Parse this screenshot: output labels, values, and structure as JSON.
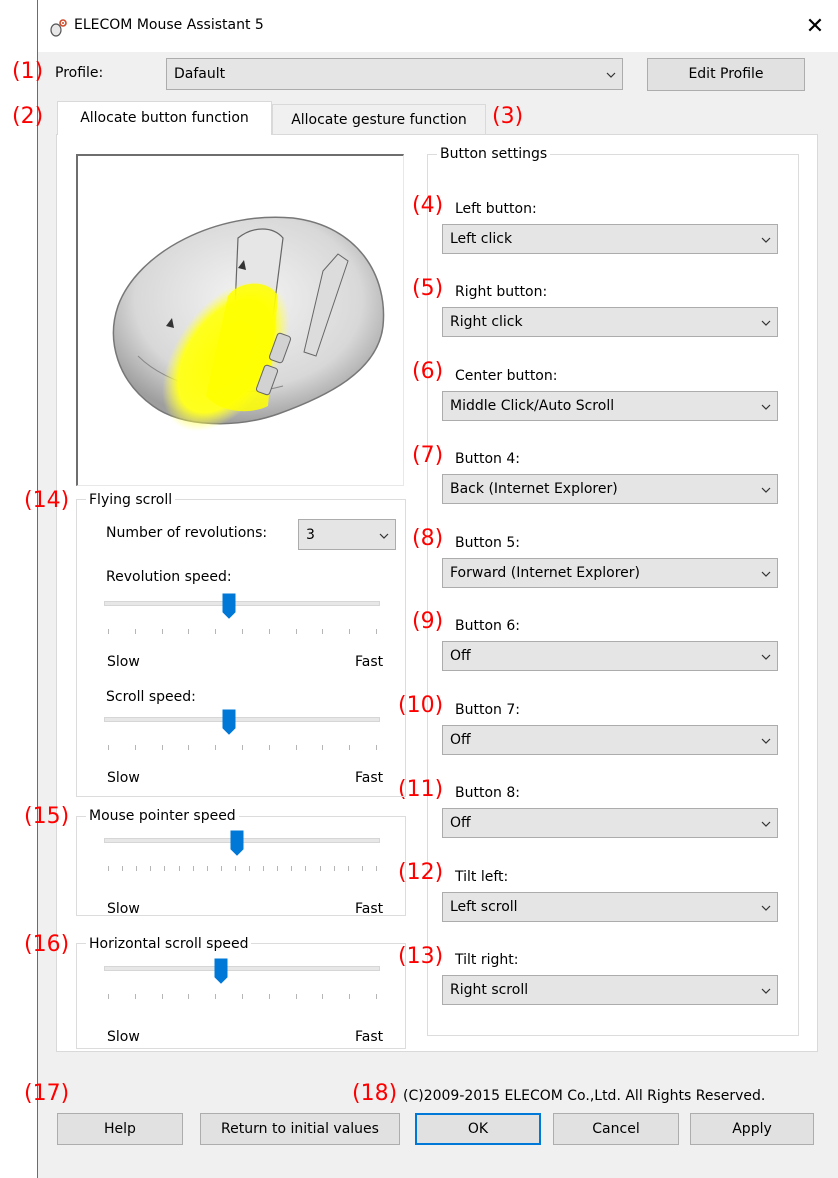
{
  "window": {
    "title": "ELECOM Mouse Assistant 5",
    "close_glyph": "✕"
  },
  "callouts": {
    "c1": "(1)",
    "c2": "(2)",
    "c3": "(3)",
    "c4": "(4)",
    "c5": "(5)",
    "c6": "(6)",
    "c7": "(7)",
    "c8": "(8)",
    "c9": "(9)",
    "c10": "(10)",
    "c11": "(11)",
    "c12": "(12)",
    "c13": "(13)",
    "c14": "(14)",
    "c15": "(15)",
    "c16": "(16)",
    "c17": "(17)",
    "c18": "(18)"
  },
  "profile": {
    "label": "Profile:",
    "value": "Dafault",
    "edit_button": "Edit Profile"
  },
  "tabs": {
    "button_function": "Allocate button function",
    "gesture_function": "Allocate gesture function"
  },
  "button_settings": {
    "title": "Button settings",
    "items": [
      {
        "label": "Left button:",
        "value": "Left click"
      },
      {
        "label": "Right button:",
        "value": "Right click"
      },
      {
        "label": "Center button:",
        "value": "Middle Click/Auto Scroll"
      },
      {
        "label": "Button 4:",
        "value": "Back (Internet Explorer)"
      },
      {
        "label": "Button 5:",
        "value": "Forward (Internet Explorer)"
      },
      {
        "label": "Button 6:",
        "value": "Off"
      },
      {
        "label": "Button 7:",
        "value": "Off"
      },
      {
        "label": "Button 8:",
        "value": "Off"
      },
      {
        "label": "Tilt left:",
        "value": "Left scroll"
      },
      {
        "label": "Tilt right:",
        "value": "Right scroll"
      }
    ]
  },
  "flying_scroll": {
    "title": "Flying scroll",
    "revolutions_label": "Number of revolutions:",
    "revolutions_value": "3",
    "revolution_speed_label": "Revolution speed:",
    "revolution_speed_level": 0.45,
    "scroll_speed_label": "Scroll speed:",
    "scroll_speed_level": 0.45,
    "slow": "Slow",
    "fast": "Fast"
  },
  "pointer_speed": {
    "title": "Mouse pointer speed",
    "level": 0.48,
    "slow": "Slow",
    "fast": "Fast"
  },
  "horizontal_scroll": {
    "title": "Horizontal scroll speed",
    "level": 0.42,
    "slow": "Slow",
    "fast": "Fast"
  },
  "footer": {
    "copyright": "(C)2009-2015 ELECOM Co.,Ltd. All Rights Reserved.",
    "help": "Help",
    "reset": "Return to initial values",
    "ok": "OK",
    "cancel": "Cancel",
    "apply": "Apply"
  },
  "colors": {
    "accent": "#0078d7",
    "callout": "#ff0000",
    "highlight": "#ffff00"
  }
}
